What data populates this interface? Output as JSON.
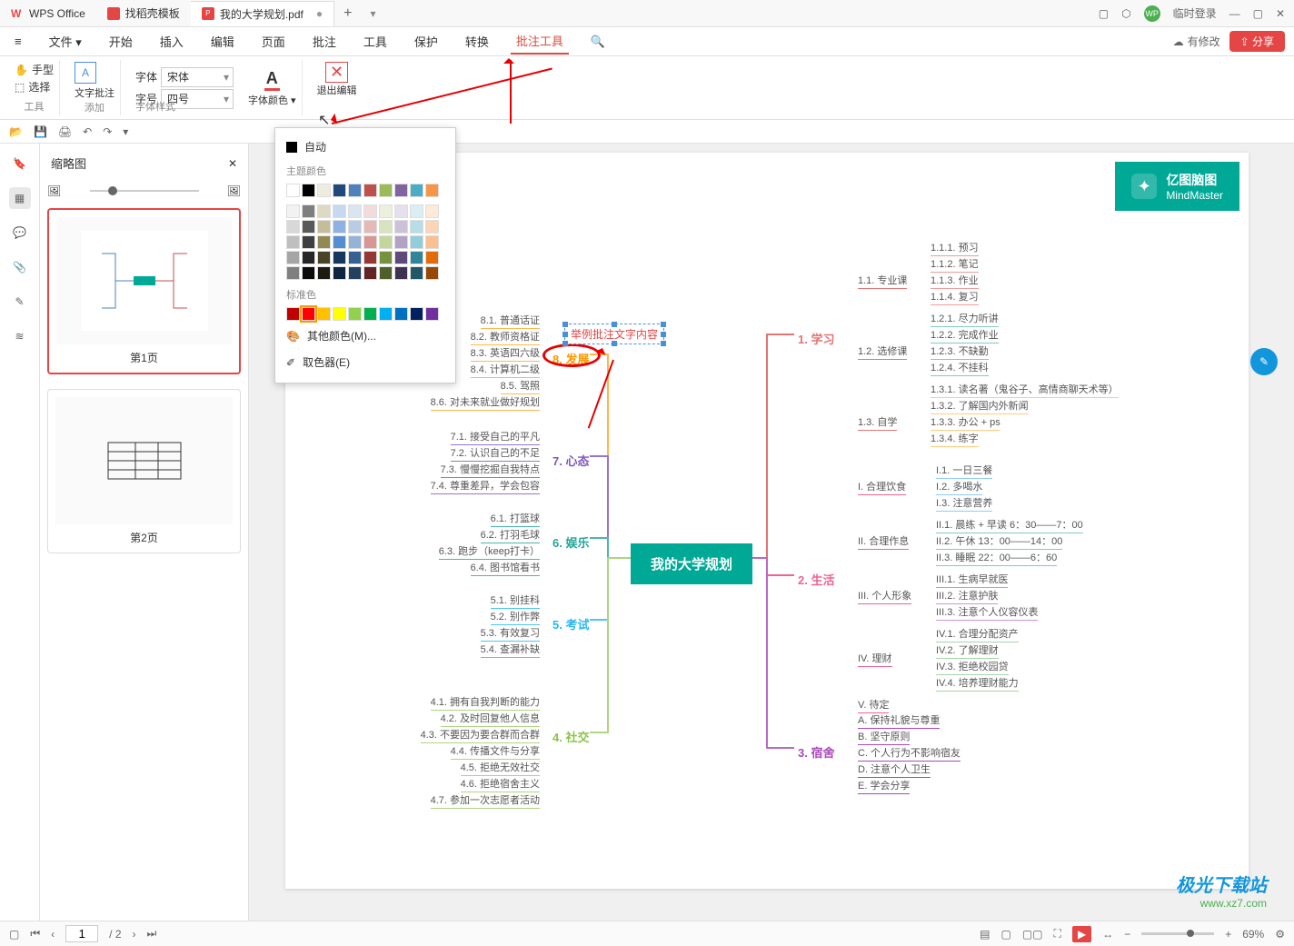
{
  "titlebar": {
    "app_name": "WPS Office",
    "tabs": [
      {
        "label": "找稻壳模板"
      },
      {
        "label": "我的大学规划.pdf",
        "active": true
      }
    ],
    "login_label": "临时登录"
  },
  "menubar": {
    "file_label": "文件",
    "items": [
      "开始",
      "插入",
      "编辑",
      "页面",
      "批注",
      "工具",
      "保护",
      "转换",
      "批注工具"
    ],
    "active": "批注工具",
    "modify_label": "有修改",
    "share_label": "分享"
  },
  "ribbon": {
    "tool_hand": "手型",
    "tool_select": "选择",
    "tool_group_label": "工具",
    "text_annotate": "文字批注",
    "add_group_label": "添加",
    "font_label": "字体",
    "font_value": "宋体",
    "size_label": "字号",
    "size_value": "四号",
    "font_color_label": "字体颜色",
    "style_group_label": "字体样式",
    "exit_label": "退出编辑"
  },
  "thumbnails": {
    "title": "缩略图",
    "pages": [
      {
        "label": "第1页",
        "selected": true
      },
      {
        "label": "第2页",
        "selected": false
      }
    ]
  },
  "colorpicker": {
    "auto_label": "自动",
    "theme_label": "主题颜色",
    "standard_label": "标准色",
    "more_label": "其他颜色(M)...",
    "eyedropper_label": "取色器(E)",
    "theme_row1": [
      "#ffffff",
      "#000000",
      "#eeece1",
      "#1f497d",
      "#4f81bd",
      "#c0504d",
      "#9bbb59",
      "#8064a2",
      "#4bacc6",
      "#f79646"
    ],
    "theme_shades": [
      [
        "#f2f2f2",
        "#7f7f7f",
        "#ddd9c3",
        "#c6d9f0",
        "#dbe5f1",
        "#f2dcdb",
        "#ebf1dd",
        "#e5e0ec",
        "#dbeef3",
        "#fdeada"
      ],
      [
        "#d8d8d8",
        "#595959",
        "#c4bd97",
        "#8db3e2",
        "#b8cce4",
        "#e5b9b7",
        "#d7e3bc",
        "#ccc1d9",
        "#b7dde8",
        "#fbd5b5"
      ],
      [
        "#bfbfbf",
        "#3f3f3f",
        "#938953",
        "#548dd4",
        "#95b3d7",
        "#d99694",
        "#c3d69b",
        "#b2a2c7",
        "#92cddc",
        "#fac08f"
      ],
      [
        "#a5a5a5",
        "#262626",
        "#494429",
        "#17365d",
        "#366092",
        "#953734",
        "#76923c",
        "#5f497a",
        "#31859b",
        "#e36c09"
      ],
      [
        "#7f7f7f",
        "#0c0c0c",
        "#1d1b10",
        "#0f243e",
        "#244061",
        "#632423",
        "#4f6128",
        "#3f3151",
        "#205867",
        "#974806"
      ]
    ],
    "standard": [
      "#c00000",
      "#ff0000",
      "#ffc000",
      "#ffff00",
      "#92d050",
      "#00b050",
      "#00b0f0",
      "#0070c0",
      "#002060",
      "#7030a0"
    ]
  },
  "mindmap": {
    "logo_title": "亿图脑图",
    "logo_sub": "MindMaster",
    "center": "我的大学规划",
    "branches_left": [
      {
        "label": "8. 发展",
        "leaves": [
          "8.1. 普通话证",
          "8.2. 教师资格证",
          "8.3. 英语四六级",
          "8.4. 计算机二级",
          "8.5. 驾照",
          "8.6. 对未来就业做好规划"
        ]
      },
      {
        "label": "7. 心态",
        "leaves": [
          "7.1. 接受自己的平凡",
          "7.2. 认识自己的不足",
          "7.3. 慢慢挖掘自我特点",
          "7.4. 尊重差异，学会包容"
        ]
      },
      {
        "label": "6. 娱乐",
        "leaves": [
          "6.1. 打篮球",
          "6.2. 打羽毛球",
          "6.3. 跑步（keep打卡）",
          "6.4. 图书馆看书"
        ]
      },
      {
        "label": "5. 考试",
        "leaves": [
          "5.1. 别挂科",
          "5.2. 别作弊",
          "5.3. 有效复习",
          "5.4. 查漏补缺"
        ]
      },
      {
        "label": "4. 社交",
        "leaves": [
          "4.1. 拥有自我判断的能力",
          "4.2. 及时回复他人信息",
          "4.3. 不要因为要合群而合群",
          "4.4. 传播文件与分享",
          "4.5. 拒绝无效社交",
          "4.6. 拒绝宿舍主义",
          "4.7. 参加一次志愿者活动"
        ]
      }
    ],
    "branches_right": [
      {
        "label": "1. 学习",
        "subs": [
          {
            "label": "1.1. 专业课",
            "leaves": [
              "1.1.1. 预习",
              "1.1.2. 笔记",
              "1.1.3. 作业",
              "1.1.4. 复习"
            ]
          },
          {
            "label": "1.2. 选修课",
            "leaves": [
              "1.2.1. 尽力听讲",
              "1.2.2. 完成作业",
              "1.2.3. 不缺勤",
              "1.2.4. 不挂科"
            ]
          },
          {
            "label": "1.3. 自学",
            "leaves": [
              "1.3.1. 读名著（鬼谷子、高情商聊天术等）",
              "1.3.2. 了解国内外新闻",
              "1.3.3. 办公 + ps",
              "1.3.4. 练字"
            ]
          }
        ]
      },
      {
        "label": "2. 生活",
        "subs": [
          {
            "label": "I. 合理饮食",
            "leaves": [
              "I.1. 一日三餐",
              "I.2. 多喝水",
              "I.3. 注意营养"
            ]
          },
          {
            "label": "II. 合理作息",
            "leaves": [
              "II.1. 晨练 + 早读 6：30——7：00",
              "II.2. 午休 13：00——14：00",
              "II.3. 睡眠 22：00——6：60"
            ]
          },
          {
            "label": "III. 个人形象",
            "leaves": [
              "III.1. 生病早就医",
              "III.2. 注意护肤",
              "III.3. 注意个人仪容仪表"
            ]
          },
          {
            "label": "IV. 理财",
            "leaves": [
              "IV.1. 合理分配资产",
              "IV.2. 了解理财",
              "IV.3. 拒绝校园贷",
              "IV.4. 培养理财能力"
            ]
          },
          {
            "label": "V. 待定",
            "leaves": []
          }
        ]
      },
      {
        "label": "3. 宿舍",
        "leaves": [
          "A. 保持礼貌与尊重",
          "B. 坚守原则",
          "C. 个人行为不影响宿友",
          "D. 注意个人卫生",
          "E. 学会分享"
        ]
      }
    ],
    "annotation_text": "举例批注文字内容"
  },
  "statusbar": {
    "page_current": "1",
    "page_total": "/ 2",
    "zoom": "69%"
  },
  "watermark": {
    "site": "极光下载站",
    "url": "www.xz7.com"
  }
}
